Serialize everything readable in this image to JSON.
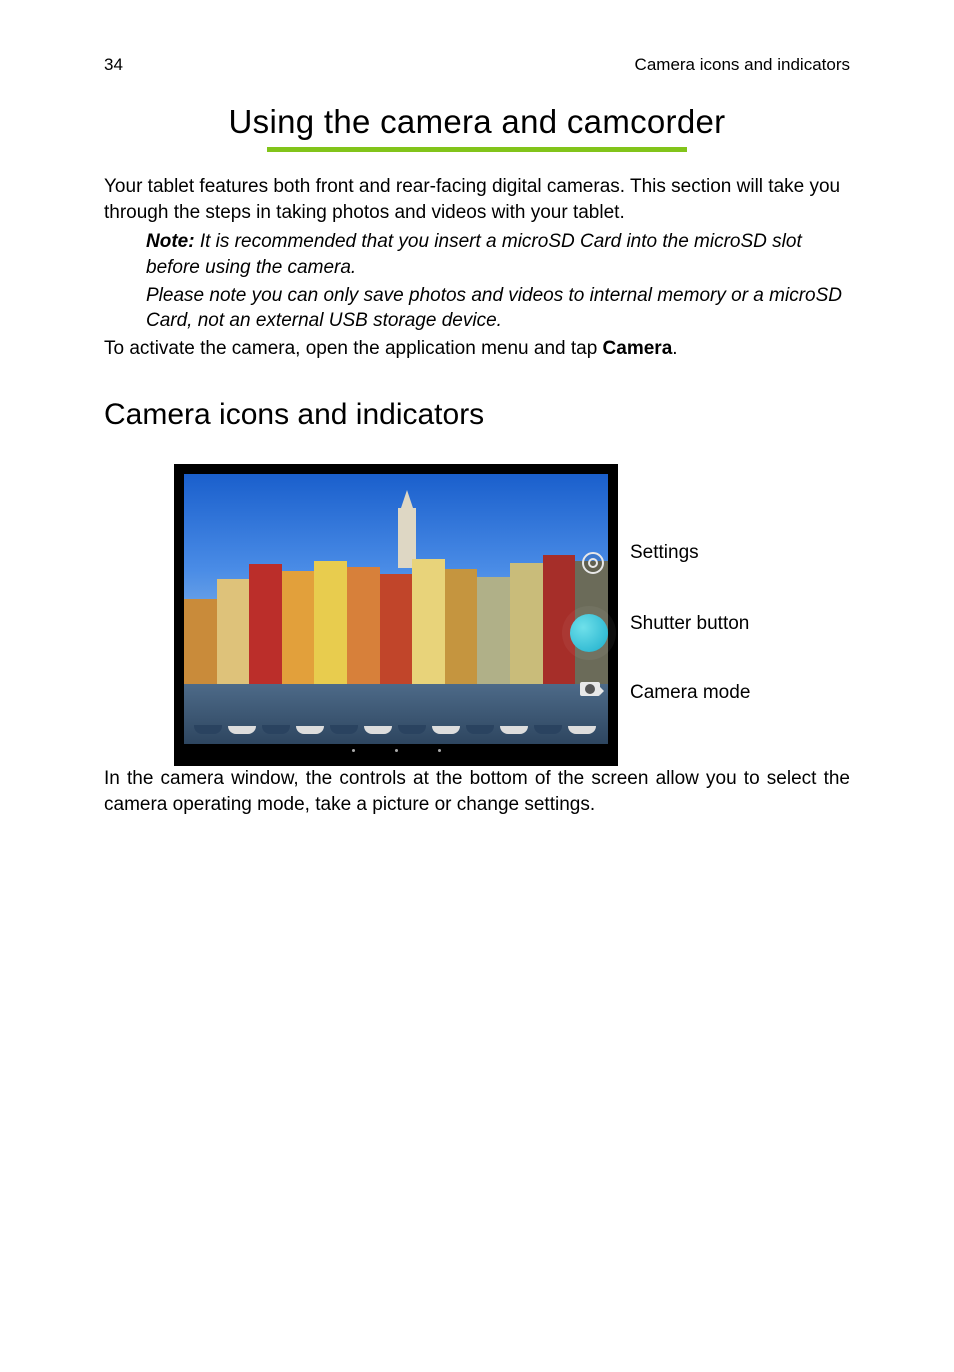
{
  "header": {
    "page_number": "34",
    "running_head": "Camera icons and indicators"
  },
  "chapter_title": "Using the camera and camcorder",
  "intro_paragraph": "Your tablet features both front and rear-facing digital cameras. This section will take you through the steps in taking photos and videos with your tablet.",
  "note": {
    "label": "Note:",
    "line1": " It is recommended that you insert a microSD Card into the microSD slot before using the camera.",
    "line2": "Please note you can only save photos and videos to internal memory or a microSD Card, not an external USB storage device."
  },
  "activate_line_pre": "To activate the camera, open the application menu and tap ",
  "activate_bold": "Camera",
  "activate_line_post": ".",
  "section_heading": "Camera icons and indicators",
  "callouts": {
    "settings": "Settings",
    "shutter": "Shutter button",
    "mode": "Camera mode"
  },
  "closing_paragraph": "In the camera window, the controls at the bottom of the screen allow you to select the camera operating mode, take a picture or change settings."
}
